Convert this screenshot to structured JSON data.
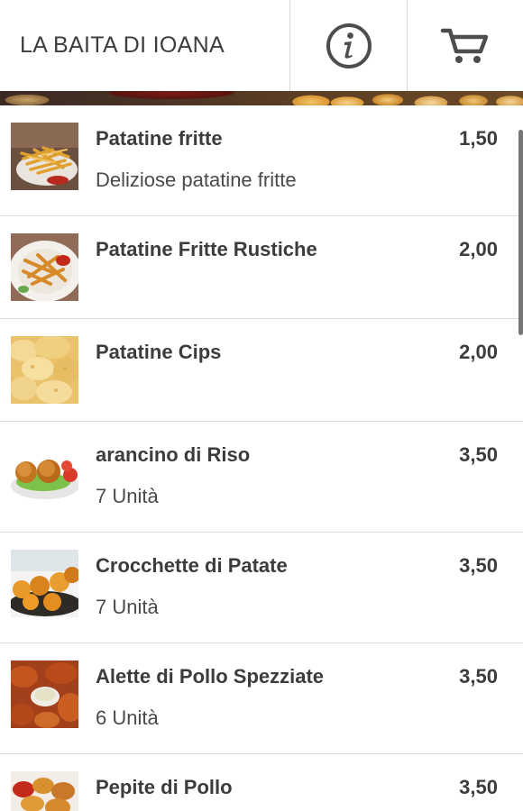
{
  "header": {
    "title": "LA BAITA DI IOANA",
    "info_icon": "info-circle-icon",
    "cart_icon": "shopping-cart-icon"
  },
  "menu_items": [
    {
      "name": "Patatine fritte",
      "price": "1,50",
      "description": "Deliziose patatine fritte",
      "image": "french-fries"
    },
    {
      "name": "Patatine Fritte Rustiche",
      "price": "2,00",
      "description": "",
      "image": "rustic-fries"
    },
    {
      "name": "Patatine Cips",
      "price": "2,00",
      "description": "",
      "image": "potato-chips"
    },
    {
      "name": "arancino di Riso",
      "price": "3,50",
      "description": "7 Unità",
      "image": "rice-balls"
    },
    {
      "name": "Crocchette di Patate",
      "price": "3,50",
      "description": "7 Unità",
      "image": "potato-croquettes"
    },
    {
      "name": "Alette di Pollo Spezziate",
      "price": "3,50",
      "description": "6 Unità",
      "image": "chicken-wings"
    },
    {
      "name": "Pepite di Pollo",
      "price": "3,50",
      "description": "",
      "image": "chicken-nuggets"
    }
  ],
  "colors": {
    "text": "#3c3c3c",
    "divider": "#dedede",
    "icon": "#4d4d4d"
  }
}
